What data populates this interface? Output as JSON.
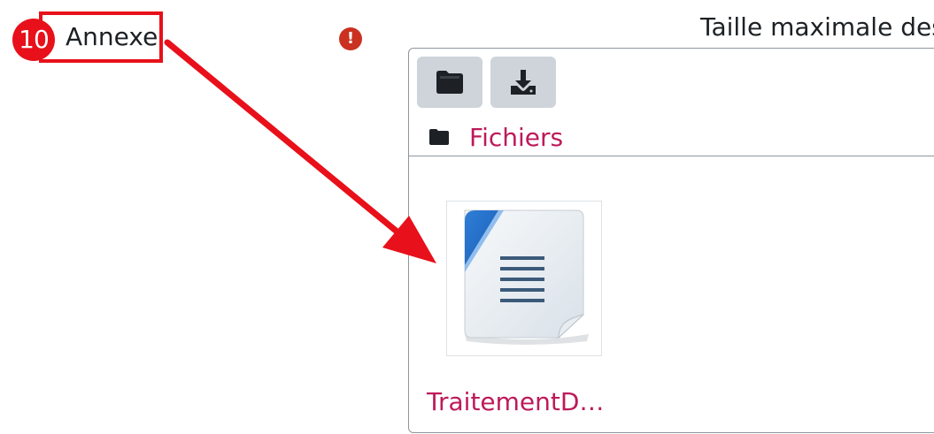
{
  "step": {
    "number": "10",
    "label": "Annexe"
  },
  "header": {
    "max_size_text": "Taille maximale des"
  },
  "required_icon": "!",
  "filemanager": {
    "toolbar": [
      "folder-icon",
      "download-icon"
    ],
    "breadcrumb": {
      "label": "Fichiers"
    },
    "files": [
      {
        "name": "TraitementD…",
        "icon": "text-document-icon"
      }
    ]
  },
  "colors": {
    "annotation_red": "#e8101a",
    "required_red": "#ca3120",
    "link_magenta": "#bd1a5a",
    "toolbar_button_bg": "#ced4da"
  }
}
